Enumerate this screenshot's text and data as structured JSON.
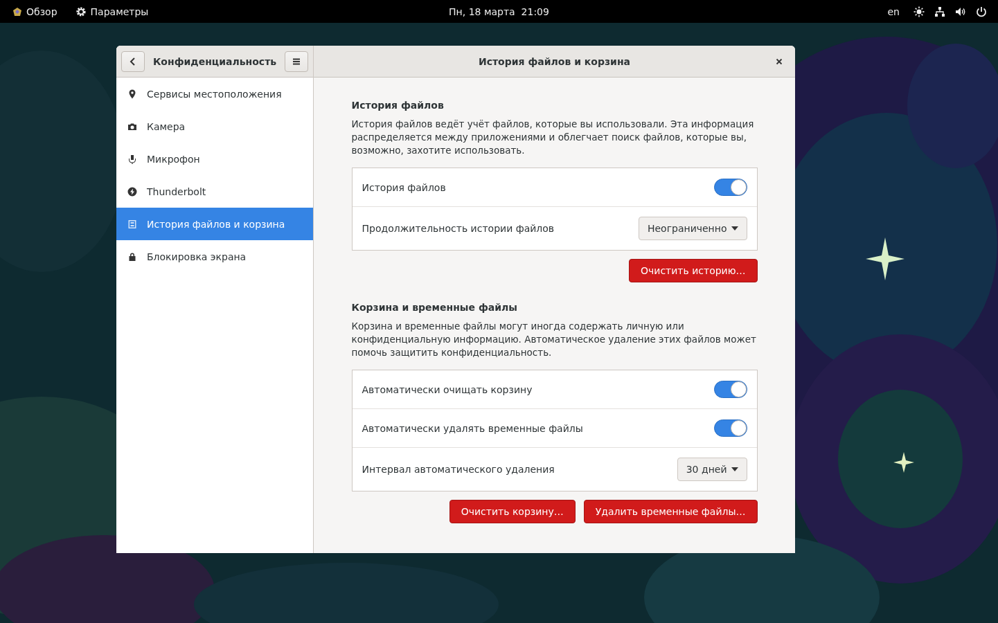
{
  "top_bar": {
    "activities": "Обзор",
    "app_menu": "Параметры",
    "clock": "Пн, 18 марта  21:09",
    "keyboard_layout": "en"
  },
  "window": {
    "sidebar_title": "Конфиденциальность",
    "title": "История файлов и корзина",
    "sidebar_items": [
      {
        "kind": "pin",
        "label": "Сервисы местоположения",
        "selected": false
      },
      {
        "kind": "camera",
        "label": "Камера",
        "selected": false
      },
      {
        "kind": "mic",
        "label": "Микрофон",
        "selected": false
      },
      {
        "kind": "bolt",
        "label": "Thunderbolt",
        "selected": false
      },
      {
        "kind": "doc",
        "label": "История файлов и корзина",
        "selected": true
      },
      {
        "kind": "lock",
        "label": "Блокировка экрана",
        "selected": false
      }
    ],
    "sections": [
      {
        "heading": "История файлов",
        "description": "История файлов ведёт учёт файлов, которые вы использовали. Эта информация распределяется между приложениями и облегчает поиск файлов, которые вы, возможно, захотите использовать.",
        "rows": [
          {
            "kind": "switch",
            "label": "История файлов",
            "on": true
          },
          {
            "kind": "dropdown",
            "label": "Продолжительность истории файлов",
            "value": "Неограниченно"
          }
        ],
        "buttons": [
          "Очистить историю…"
        ]
      },
      {
        "heading": "Корзина и временные файлы",
        "description": "Корзина и временные файлы могут иногда содержать личную или конфиденциальную информацию. Автоматическое удаление этих файлов может помочь защитить конфиденциальность.",
        "rows": [
          {
            "kind": "switch",
            "label": "Автоматически очищать корзину",
            "on": true
          },
          {
            "kind": "switch",
            "label": "Автоматически удалять временные файлы",
            "on": true
          },
          {
            "kind": "dropdown",
            "label": "Интервал автоматического удаления",
            "value": "30 дней"
          }
        ],
        "buttons": [
          "Очистить корзину…",
          "Удалить временные файлы…"
        ]
      }
    ]
  }
}
